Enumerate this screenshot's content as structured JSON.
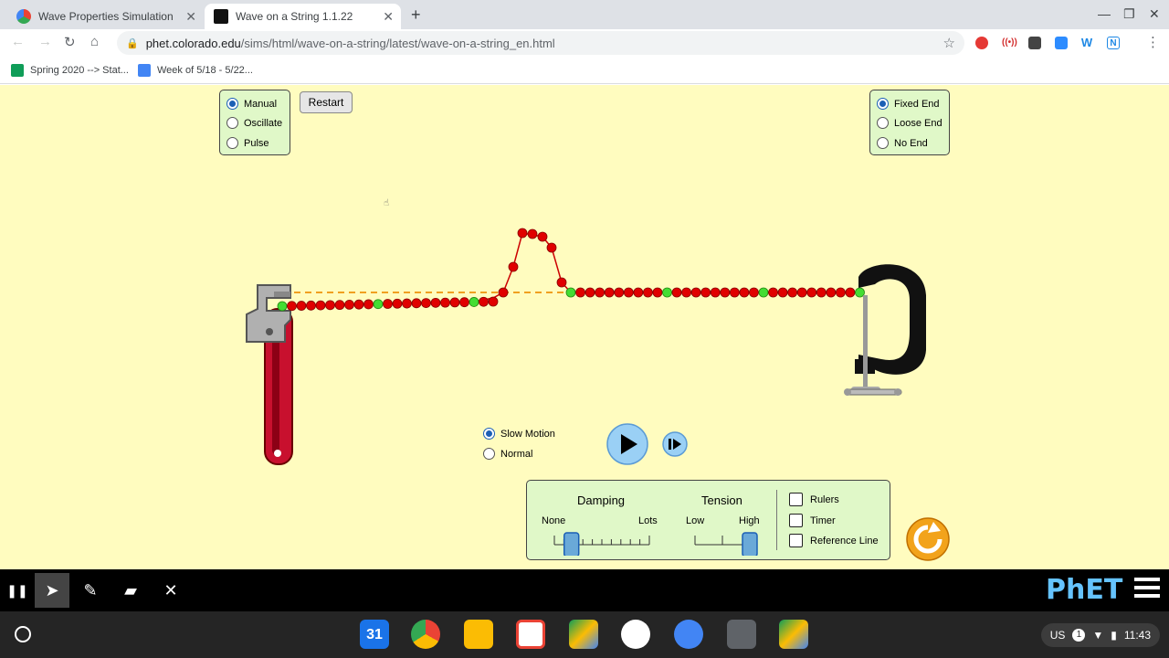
{
  "browser": {
    "tabs": [
      {
        "title": "Wave Properties Simulation - For",
        "active": false
      },
      {
        "title": "Wave on a String 1.1.22",
        "active": true
      }
    ],
    "url_host": "phet.colorado.edu",
    "url_path": "/sims/html/wave-on-a-string/latest/wave-on-a-string_en.html",
    "bookmarks": [
      "Spring 2020 --> Stat...",
      "Week of 5/18 - 5/22..."
    ]
  },
  "sim": {
    "mode_options": [
      "Manual",
      "Oscillate",
      "Pulse"
    ],
    "mode_selected": "Manual",
    "restart_label": "Restart",
    "end_options": [
      "Fixed End",
      "Loose End",
      "No End"
    ],
    "end_selected": "Fixed End",
    "speed_options": [
      "Slow Motion",
      "Normal"
    ],
    "speed_selected": "Slow Motion",
    "damping": {
      "label": "Damping",
      "min_label": "None",
      "max_label": "Lots",
      "value_fraction": 0.18
    },
    "tension": {
      "label": "Tension",
      "min_label": "Low",
      "max_label": "High",
      "value_fraction": 1.0
    },
    "checkboxes": [
      "Rulers",
      "Timer",
      "Reference Line"
    ],
    "colors": {
      "background": "#fffcbf",
      "panel": "#e0f8c8",
      "bead_red": "#e00000",
      "bead_green": "#44dd33",
      "accent": "#f0a010"
    }
  },
  "brand": {
    "logo_text": "PhET"
  },
  "system_tray": {
    "locale": "US",
    "notifications": "1",
    "time": "11:43"
  }
}
